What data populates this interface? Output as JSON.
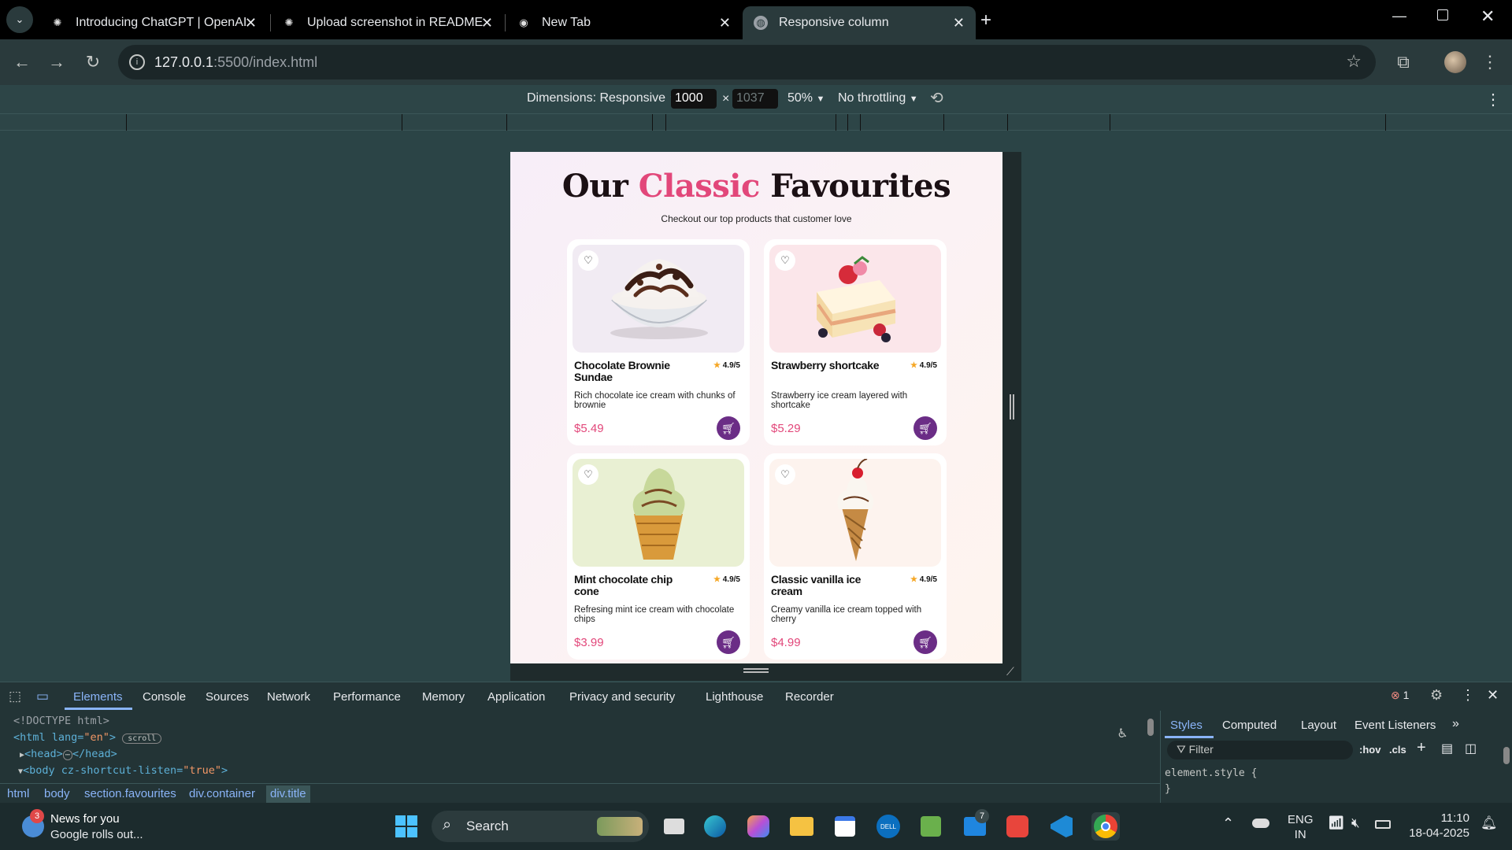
{
  "browser": {
    "tabs": [
      {
        "title": "Introducing ChatGPT | OpenAI",
        "icon": "openai-icon"
      },
      {
        "title": "Upload screenshot in README",
        "icon": "openai-icon"
      },
      {
        "title": "New Tab",
        "icon": "chrome-icon"
      },
      {
        "title": "Responsive column",
        "icon": "globe-icon",
        "active": true
      }
    ],
    "url_host": "127.0.0.1",
    "url_rest": ":5500/index.html"
  },
  "device_toolbar": {
    "dimensions_label": "Dimensions: Responsive",
    "width": "1000",
    "height_placeholder": "1037",
    "times": "×",
    "zoom": "50%",
    "throttling": "No throttling"
  },
  "page": {
    "title_part1": "Our",
    "title_part2": "Classic",
    "title_part3": "Favourites",
    "subtitle": "Checkout our top products that customer love",
    "accent_color": "#e2477a",
    "cart_color": "#6b2d86",
    "products": [
      {
        "name": "Chocolate Brownie Sundae",
        "rating": "4.9/5",
        "description": "Rich chocolate ice cream with chunks of brownie",
        "price": "$5.49"
      },
      {
        "name": "Strawberry shortcake",
        "rating": "4.9/5",
        "description": "Strawberry ice cream layered with shortcake",
        "price": "$5.29"
      },
      {
        "name": "Mint chocolate chip cone",
        "rating": "4.9/5",
        "description": "Refresing mint ice cream with chocolate chips",
        "price": "$3.99"
      },
      {
        "name": "Classic vanilla ice cream",
        "rating": "4.9/5",
        "description": "Creamy vanilla ice cream topped with cherry",
        "price": "$4.99"
      }
    ]
  },
  "devtools": {
    "tabs": [
      "Elements",
      "Console",
      "Sources",
      "Network",
      "Performance",
      "Memory",
      "Application",
      "Privacy and security",
      "Lighthouse",
      "Recorder"
    ],
    "error_count": "1",
    "breadcrumbs": [
      "html",
      "body",
      "section.favourites",
      "div.container",
      "div.title"
    ],
    "styles_tabs": [
      "Styles",
      "Computed",
      "Layout",
      "Event Listeners"
    ],
    "filter_placeholder": "Filter",
    "hov": ":hov",
    "cls": ".cls",
    "element_style": "element.style {",
    "element_style_close": "}",
    "scroll_badge": "scroll",
    "code": {
      "doctype": "<!DOCTYPE html>",
      "html_open": "<html lang=",
      "html_lang": "\"en\"",
      "head": "<head>",
      "head_close": "</head>",
      "body_open": "<body cz-shortcut-listen=",
      "body_attr": "\"true\"",
      "ellipsis": "⋯"
    }
  },
  "taskbar": {
    "news_title": "News for you",
    "news_sub": "Google rolls out...",
    "news_badge": "3",
    "search_label": "Search",
    "language": "ENG",
    "region": "IN",
    "time": "11:10",
    "date": "18-04-2025",
    "mail_badge": "7"
  }
}
